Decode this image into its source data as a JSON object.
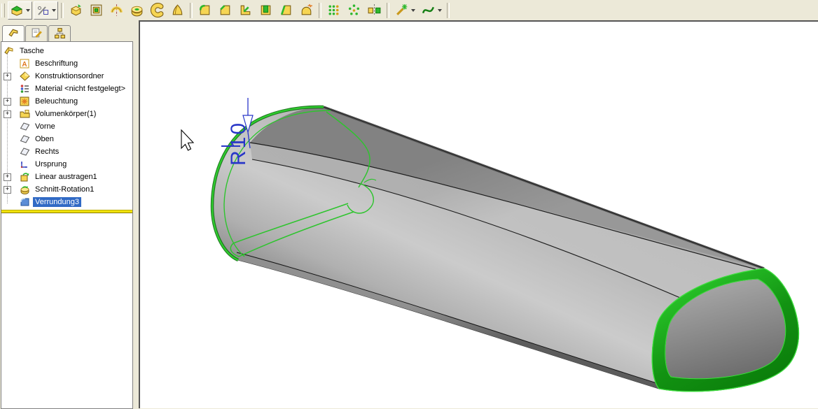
{
  "toolbar": {
    "groups": [
      {
        "name": "flyouts",
        "icons": [
          "features-flyout-icon",
          "sketch-flyout-icon"
        ]
      },
      {
        "name": "boss-base-features",
        "icons": [
          "extruded-boss-icon",
          "extruded-cut-icon",
          "revolved-boss-icon",
          "revolved-cut-icon",
          "swept-icon",
          "lofted-icon"
        ]
      },
      {
        "name": "applied-features",
        "icons": [
          "fillet-icon",
          "chamfer-icon",
          "rib-icon",
          "shell-icon",
          "draft-icon",
          "dome-icon"
        ]
      },
      {
        "name": "patterns",
        "icons": [
          "linear-pattern-icon",
          "circular-pattern-icon",
          "mirror-icon"
        ]
      },
      {
        "name": "wizard-curves",
        "icons": [
          "hole-wizard-icon",
          "curves-icon"
        ]
      }
    ]
  },
  "sidebar": {
    "tabs": [
      {
        "name": "featuremanager-tab"
      },
      {
        "name": "propertymanager-tab"
      },
      {
        "name": "configurationmanager-tab"
      }
    ],
    "tree": {
      "root_label": "Tasche",
      "items": [
        {
          "label": "Beschriftung",
          "icon": "annotation-icon",
          "expandable": false,
          "selected": false
        },
        {
          "label": "Konstruktionsordner",
          "icon": "construction-folder-icon",
          "expandable": true,
          "selected": false
        },
        {
          "label": "Material <nicht festgelegt>",
          "icon": "material-icon",
          "expandable": false,
          "selected": false
        },
        {
          "label": "Beleuchtung",
          "icon": "lighting-icon",
          "expandable": true,
          "selected": false
        },
        {
          "label": "Volumenkörper(1)",
          "icon": "solid-bodies-folder-icon",
          "expandable": true,
          "selected": false
        },
        {
          "label": "Vorne",
          "icon": "plane-icon",
          "expandable": false,
          "selected": false
        },
        {
          "label": "Oben",
          "icon": "plane-icon",
          "expandable": false,
          "selected": false
        },
        {
          "label": "Rechts",
          "icon": "plane-icon",
          "expandable": false,
          "selected": false
        },
        {
          "label": "Ursprung",
          "icon": "origin-icon",
          "expandable": false,
          "selected": false
        },
        {
          "label": "Linear austragen1",
          "icon": "extrude-feature-icon",
          "expandable": true,
          "selected": false
        },
        {
          "label": "Schnitt-Rotation1",
          "icon": "revolve-cut-feature-icon",
          "expandable": true,
          "selected": false
        },
        {
          "label": "Verrundung3",
          "icon": "fillet-feature-icon",
          "expandable": false,
          "selected": true
        }
      ]
    }
  },
  "viewport": {
    "dimension_label": "R10"
  },
  "colors": {
    "panel_bg": "#ece9d8",
    "selection_blue": "#316ac5",
    "rollback_yellow": "#f0e10a",
    "highlight_green": "#2ec42e",
    "dimension_blue": "#2836c8",
    "icon_gold": "#f6d553"
  }
}
